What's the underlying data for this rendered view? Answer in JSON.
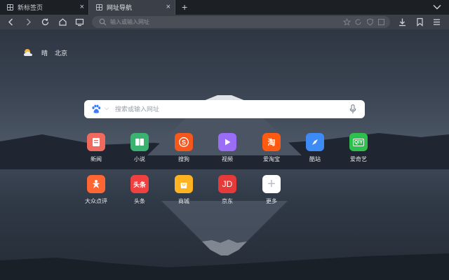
{
  "tabs": [
    {
      "label": "新标签页",
      "close": "×"
    },
    {
      "label": "网址导航",
      "close": "×"
    }
  ],
  "new_tab": "+",
  "address_bar": {
    "placeholder": "输入或输入网址"
  },
  "weather": {
    "condition": "晴",
    "city": "北京"
  },
  "search": {
    "placeholder": "搜索或输入网址"
  },
  "shortcuts": [
    {
      "label": "新闻",
      "glyph": "",
      "color": "#f06a5e"
    },
    {
      "label": "小说",
      "glyph": "",
      "color": "#39b36f"
    },
    {
      "label": "搜狗",
      "glyph": "S",
      "color": "#f5571d"
    },
    {
      "label": "视频",
      "glyph": "",
      "color": "#9b6cf5"
    },
    {
      "label": "爱淘宝",
      "glyph": "淘",
      "color": "#ff5a12"
    },
    {
      "label": "酷站",
      "glyph": "",
      "color": "#3d8cf5"
    },
    {
      "label": "爱奇艺",
      "glyph": "QIY",
      "color": "#2fbf4d"
    },
    {
      "label": "大众点评",
      "glyph": "",
      "color": "#ff6633"
    },
    {
      "label": "头条",
      "glyph": "头条",
      "color": "#f04040"
    },
    {
      "label": "商城",
      "glyph": "",
      "color": "#ffb320"
    },
    {
      "label": "京东",
      "glyph": "JD",
      "color": "#e63a3a"
    },
    {
      "label": "更多",
      "glyph": "+",
      "color": "#ffffff"
    }
  ]
}
